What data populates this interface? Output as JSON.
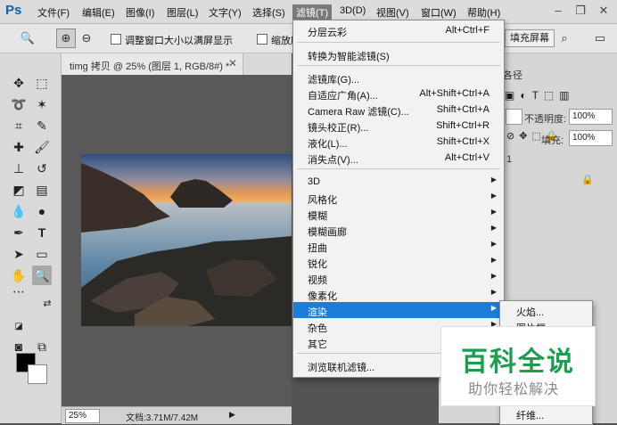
{
  "app": {
    "logo": "Ps"
  },
  "menubar": {
    "items": [
      "文件(F)",
      "编辑(E)",
      "图像(I)",
      "图层(L)",
      "文字(Y)",
      "选择(S)",
      "滤镜(T)",
      "3D(D)",
      "视图(V)",
      "窗口(W)",
      "帮助(H)"
    ]
  },
  "options_bar": {
    "resize_windows_label": "调整窗口大小以满屏显示",
    "zoom_all_label": "缩放所有",
    "fill_screen_label": "填充屏幕"
  },
  "document": {
    "tab_title": "timg 拷贝 @ 25% (图层 1, RGB/8#) *",
    "zoom": "25%",
    "doc_size": "文档:3.71M/7.42M"
  },
  "right_panel": {
    "tab_fragment": "各径",
    "opacity_label": "不透明度:",
    "opacity_value": "100%",
    "fill_label": "填充:",
    "fill_value": "100%",
    "layer_fragment": "1"
  },
  "filter_menu": {
    "items": [
      {
        "label": "分层云彩",
        "shortcut": "Alt+Ctrl+F"
      },
      {
        "label": "转换为智能滤镜(S)"
      },
      {
        "label": "滤镜库(G)..."
      },
      {
        "label": "自适应广角(A)...",
        "shortcut": "Alt+Shift+Ctrl+A"
      },
      {
        "label": "Camera Raw 滤镜(C)...",
        "shortcut": "Shift+Ctrl+A"
      },
      {
        "label": "镜头校正(R)...",
        "shortcut": "Shift+Ctrl+R"
      },
      {
        "label": "液化(L)...",
        "shortcut": "Shift+Ctrl+X"
      },
      {
        "label": "消失点(V)...",
        "shortcut": "Alt+Ctrl+V"
      },
      {
        "label": "3D"
      },
      {
        "label": "风格化"
      },
      {
        "label": "模糊"
      },
      {
        "label": "模糊画廊"
      },
      {
        "label": "扭曲"
      },
      {
        "label": "锐化"
      },
      {
        "label": "视频"
      },
      {
        "label": "像素化"
      },
      {
        "label": "渲染"
      },
      {
        "label": "杂色"
      },
      {
        "label": "其它"
      },
      {
        "label": "浏览联机滤镜..."
      }
    ]
  },
  "render_submenu": {
    "items": [
      "火焰...",
      "图片框...",
      "纤维..."
    ]
  },
  "watermark": {
    "title": "百科全说",
    "subtitle": "助你轻松解决"
  },
  "colors": {
    "menu_highlight": "#1b7dd7",
    "watermark_green": "#1e9d4f",
    "foreground": "#000000",
    "background": "#ffffff"
  }
}
